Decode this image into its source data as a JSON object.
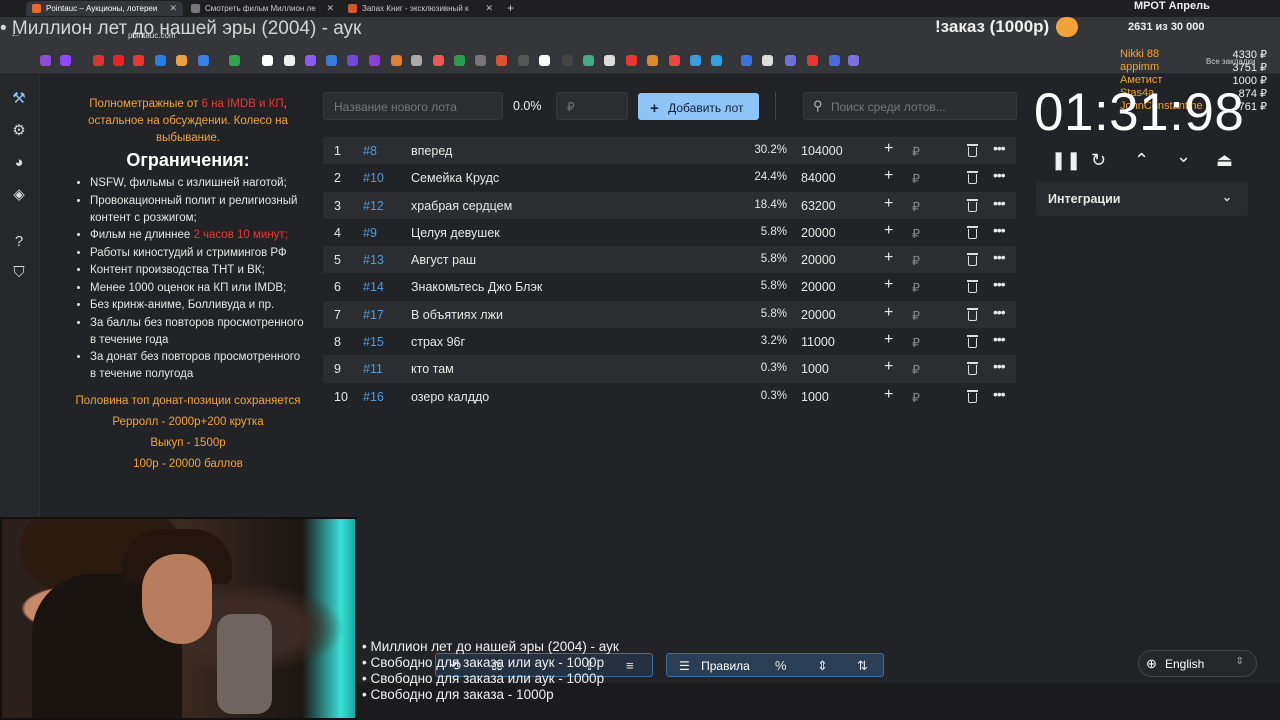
{
  "browser": {
    "tabs": [
      {
        "title": "Pointauc – Аукционы, лотереи"
      },
      {
        "title": "Смотреть фильм Миллион ле"
      },
      {
        "title": "Запах Книг - эксклюзивный к"
      }
    ],
    "url": "pointauc.com",
    "bookmarks_label": "Все закладки"
  },
  "overlay": {
    "stream_title": "• Миллион лет до нашей эры (2004) - аук",
    "order_badge": "!заказ (1000р)",
    "mrot": "МРОТ Апрель",
    "counter": "2631  из 30 000",
    "donors": [
      {
        "name": "Nikki 88",
        "amount": "4330 ₽"
      },
      {
        "name": "appimm",
        "amount": "3751 ₽"
      },
      {
        "name": "Аметист",
        "amount": "1000 ₽"
      },
      {
        "name": "Stas4a",
        "amount": "874 ₽"
      },
      {
        "name": "JohnConstantine",
        "amount": "761 ₽"
      }
    ],
    "ticker": [
      "• Миллион лет до нашей эры (2004) - аук",
      "• Свободно для заказа или аук - 1000р",
      "• Свободно для заказа или аук - 1000р",
      "• Свободно для заказа - 1000р"
    ]
  },
  "rules": {
    "intro_part1": "Полнометражные от ",
    "intro_red": "6 на IMDB и КП",
    "intro_part2": ", остальное на обсуждении. Колесо на выбывание.",
    "heading": "Ограничения:",
    "items": [
      "NSFW, фильмы с излишней наготой;",
      "Провокационный полит и религиозный контент с розжигом;",
      "Фильм не длиннее ",
      "Работы киностудий и стримингов РФ",
      "Контент производства ТНТ и ВК;",
      "Менее 1000 оценок на КП или IMDB;",
      "Без кринж-аниме, Болливуда и пр.",
      "За баллы без повторов просмотренного в течение года",
      "За донат без повторов просмотренного в течение полугода"
    ],
    "length_red": "2 часов 10 минут;",
    "footer": [
      "Половина топ донат-позиции сохраняется",
      "Рерролл - 2000р+200 крутка",
      "Выкуп - 1500р",
      "100р - 20000 баллов"
    ]
  },
  "controls": {
    "new_lot_placeholder": "Название нового лота",
    "percent": "0.0%",
    "amount_placeholder": "₽",
    "add_button": "Добавить лот",
    "search_placeholder": "Поиск среди лотов..."
  },
  "lots": [
    {
      "num": "1",
      "id": "#8",
      "name": "вперед",
      "pct": "30.2%",
      "amount": "104000"
    },
    {
      "num": "2",
      "id": "#10",
      "name": "Семейка Крудс",
      "pct": "24.4%",
      "amount": "84000"
    },
    {
      "num": "3",
      "id": "#12",
      "name": "храбрая сердцем",
      "pct": "18.4%",
      "amount": "63200"
    },
    {
      "num": "4",
      "id": "#9",
      "name": "Целуя девушек",
      "pct": "5.8%",
      "amount": "20000"
    },
    {
      "num": "5",
      "id": "#13",
      "name": "Август раш",
      "pct": "5.8%",
      "amount": "20000"
    },
    {
      "num": "6",
      "id": "#14",
      "name": "Знакомьтесь Джо Блэк",
      "pct": "5.8%",
      "amount": "20000"
    },
    {
      "num": "7",
      "id": "#17",
      "name": "В объятиях лжи",
      "pct": "5.8%",
      "amount": "20000"
    },
    {
      "num": "8",
      "id": "#15",
      "name": "страх 96г",
      "pct": "3.2%",
      "amount": "11000"
    },
    {
      "num": "9",
      "id": "#11",
      "name": "кто там",
      "pct": "0.3%",
      "amount": "1000"
    },
    {
      "num": "10",
      "id": "#16",
      "name": "озеро калддо",
      "pct": "0.3%",
      "amount": "1000"
    }
  ],
  "row_icons": {
    "plus": "+",
    "currency": "₽",
    "more": "•••"
  },
  "timer": {
    "value": "01:31:98"
  },
  "integrations": {
    "label": "Интеграции"
  },
  "toolbar": {
    "rules_label": "Правила"
  },
  "language": {
    "selected": "English"
  }
}
